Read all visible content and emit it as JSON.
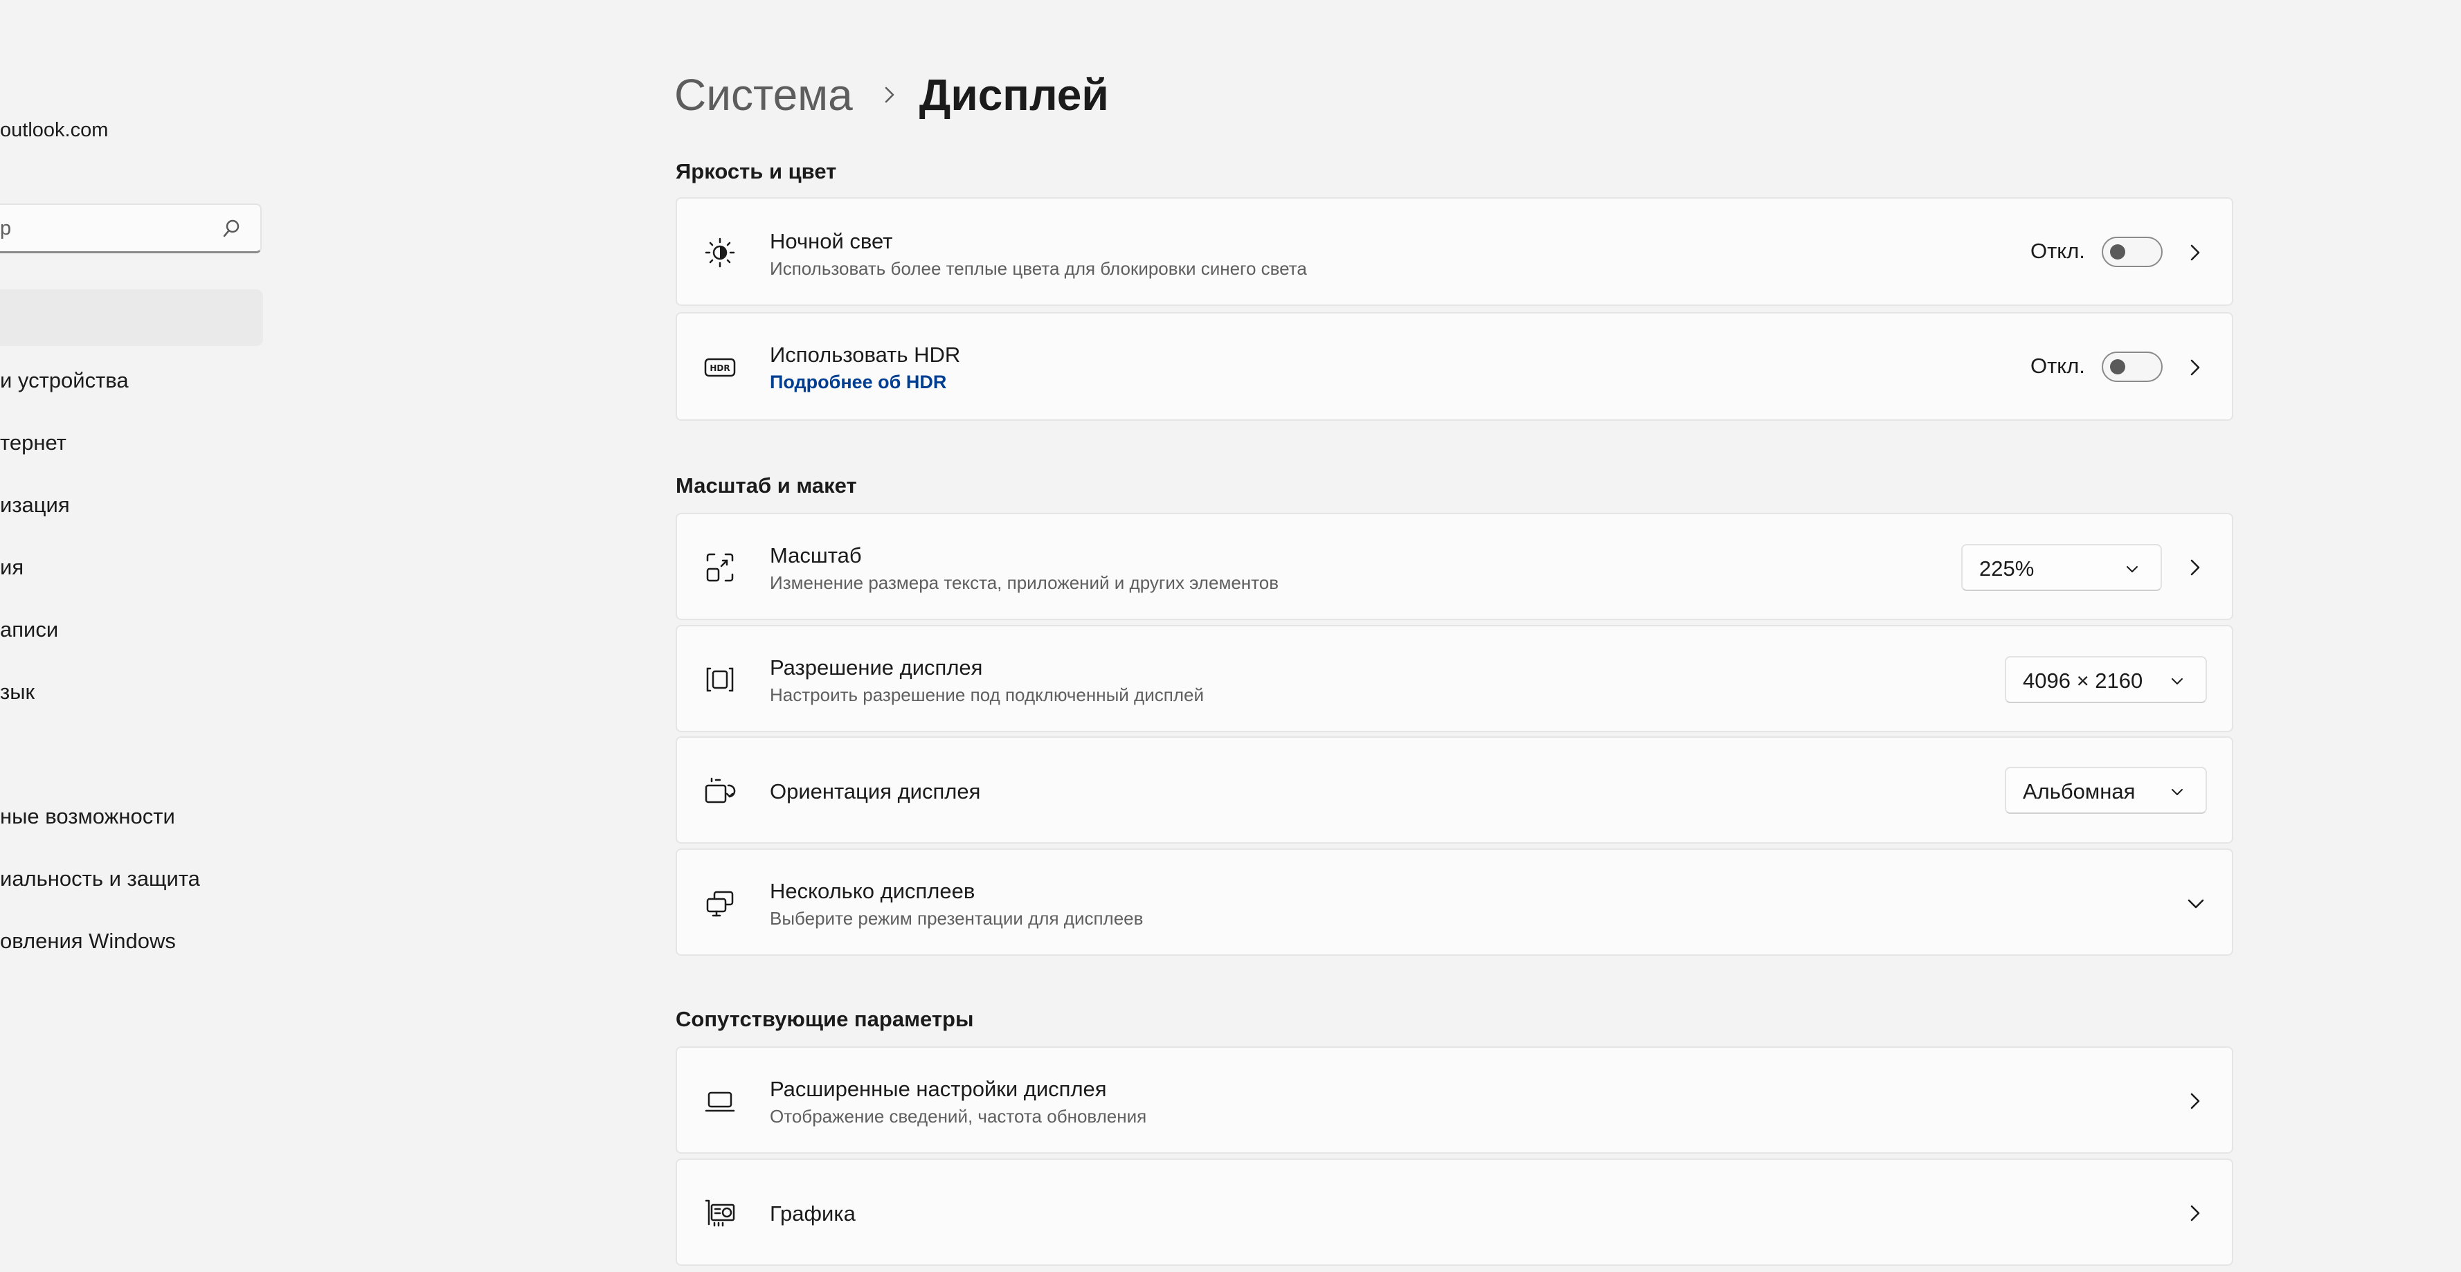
{
  "sidebar": {
    "account_email": "outlook.com",
    "search_placeholder": "р",
    "items": [
      {
        "label": "и устройства"
      },
      {
        "label": "тернет"
      },
      {
        "label": "изация"
      },
      {
        "label": "ия"
      },
      {
        "label": "аписи"
      },
      {
        "label": "зык"
      },
      {
        "label": "ные возможности"
      },
      {
        "label": "иальность и защита"
      },
      {
        "label": "овления Windows"
      }
    ]
  },
  "header": {
    "parent": "Система",
    "current": "Дисплей"
  },
  "sections": {
    "brightness": {
      "title": "Яркость и цвет",
      "night_light": {
        "title": "Ночной свет",
        "subtitle": "Использовать более теплые цвета для блокировки синего света",
        "state_label": "Откл.",
        "on": false
      },
      "hdr": {
        "title": "Использовать HDR",
        "link": "Подробнее об HDR",
        "state_label": "Откл.",
        "on": false
      }
    },
    "scale_layout": {
      "title": "Масштаб и макет",
      "scale": {
        "title": "Масштаб",
        "subtitle": "Изменение размера текста, приложений и других элементов",
        "value": "225%"
      },
      "resolution": {
        "title": "Разрешение дисплея",
        "subtitle": "Настроить разрешение под подключенный дисплей",
        "value": "4096 × 2160"
      },
      "orientation": {
        "title": "Ориентация дисплея",
        "value": "Альбомная"
      },
      "multiple": {
        "title": "Несколько дисплеев",
        "subtitle": "Выберите режим презентации для дисплеев"
      }
    },
    "related": {
      "title": "Сопутствующие параметры",
      "advanced": {
        "title": "Расширенные настройки дисплея",
        "subtitle": "Отображение сведений, частота обновления"
      },
      "graphics": {
        "title": "Графика"
      }
    }
  },
  "icons": {
    "hdr_badge": "HDR"
  }
}
